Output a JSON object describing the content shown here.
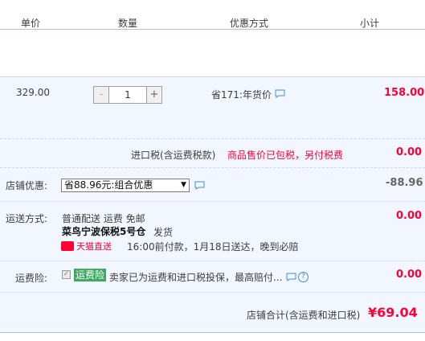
{
  "header": {
    "col_unit_price": "单价",
    "col_quantity": "数量",
    "col_discount": "优惠方式",
    "col_subtotal": "小计"
  },
  "item": {
    "unit_price": "329.00",
    "quantity": "1",
    "minus_label": "-",
    "plus_label": "+",
    "discount_text": "省171:年货价",
    "subtotal": "158.00"
  },
  "tax": {
    "label": "进口税(含运费税款)",
    "notice": "商品售价已包税，另付税费",
    "amount": "0.00"
  },
  "shop_discount": {
    "label": "店铺优惠:",
    "selected_option": "省88.96元:组合优惠",
    "amount": "-88.96"
  },
  "shipping": {
    "label": "运送方式:",
    "method": "普通配送 运费 免邮",
    "warehouse": "菜鸟宁波保税5号仓",
    "ship_word": "发货",
    "badge": "天猫直送",
    "promise": "16:00前付款，1月18日送达，晚到必赔",
    "amount": "0.00"
  },
  "insurance": {
    "label": "运费险:",
    "checked_mark": "✓",
    "badge": "运费险",
    "desc": "卖家已为运费和进口税投保，最高赔付...",
    "help_label": "?",
    "amount": "0.00"
  },
  "total": {
    "label": "店铺合计(含运费和进口税)",
    "amount": "¥69.04"
  },
  "colors": {
    "accent_red": "#ff0036",
    "row_bg": "#f2f7ff",
    "insurance_green": "#3fa95f",
    "link_blue": "#3b8fd6"
  }
}
